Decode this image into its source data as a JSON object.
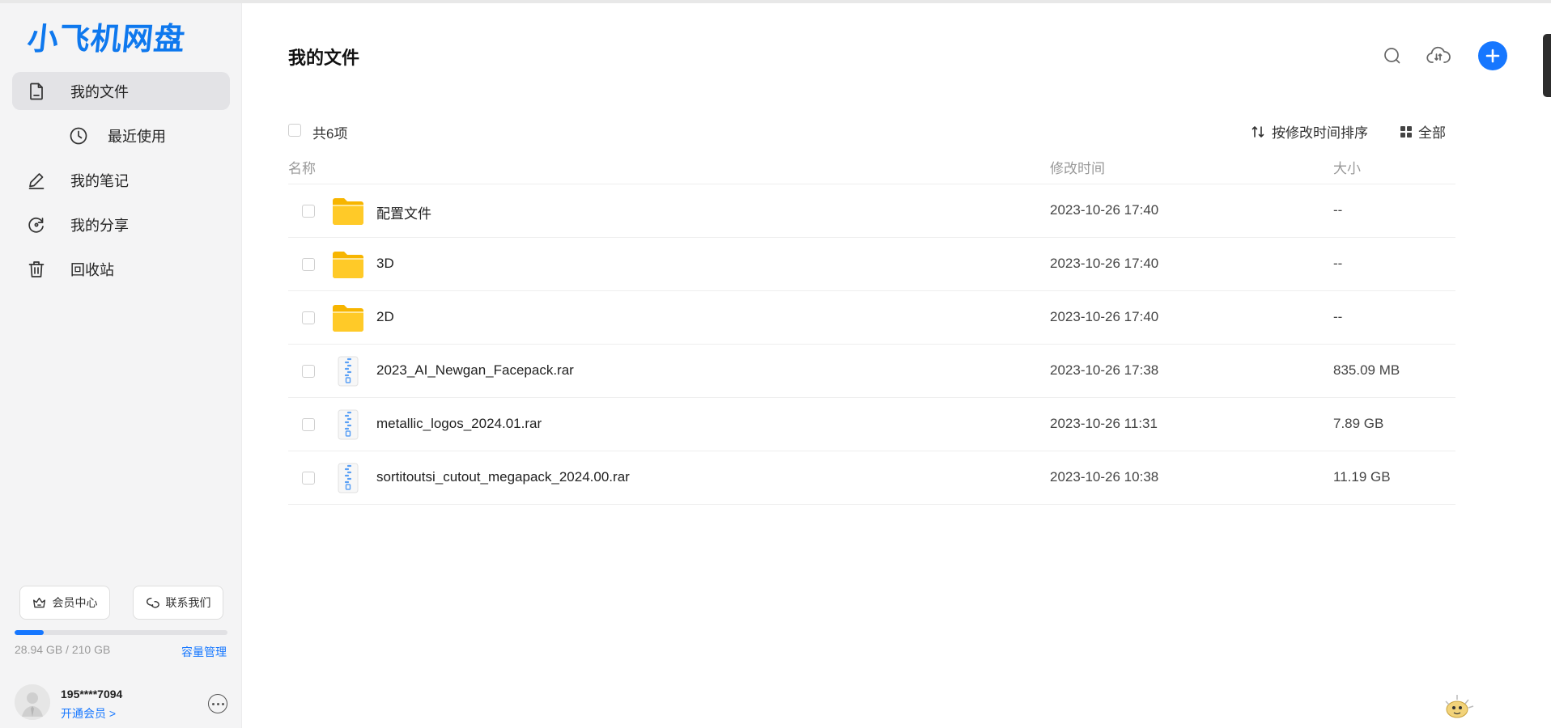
{
  "app": {
    "logo_text": "小飞机网盘",
    "brand_color": "#1677ff"
  },
  "sidebar": {
    "items": [
      {
        "label": "我的文件",
        "icon": "file-icon",
        "active": true
      },
      {
        "label": "最近使用",
        "icon": "clock-icon",
        "active": false
      },
      {
        "label": "我的笔记",
        "icon": "pen-icon",
        "active": false
      },
      {
        "label": "我的分享",
        "icon": "share-icon",
        "active": false
      },
      {
        "label": "回收站",
        "icon": "trash-icon",
        "active": false
      }
    ],
    "member_center_label": "会员中心",
    "contact_label": "联系我们",
    "storage": {
      "text": "28.94 GB / 210 GB",
      "used_fraction": 0.138,
      "manage_label": "容量管理"
    },
    "user": {
      "name": "195****7094",
      "vip_link": "开通会员 >"
    }
  },
  "main": {
    "title": "我的文件",
    "toolbar": {
      "count": "共6项",
      "sort_label": "按修改时间排序",
      "view_label": "全部"
    },
    "columns": {
      "name": "名称",
      "date": "修改时间",
      "size": "大小"
    },
    "files": [
      {
        "name": "配置文件",
        "type": "folder",
        "date": "2023-10-26 17:40",
        "size": "--"
      },
      {
        "name": "3D",
        "type": "folder",
        "date": "2023-10-26 17:40",
        "size": "--"
      },
      {
        "name": "2D",
        "type": "folder",
        "date": "2023-10-26 17:40",
        "size": "--"
      },
      {
        "name": "2023_AI_Newgan_Facepack.rar",
        "type": "archive",
        "date": "2023-10-26 17:38",
        "size": "835.09 MB"
      },
      {
        "name": "metallic_logos_2024.01.rar",
        "type": "archive",
        "date": "2023-10-26 11:31",
        "size": "7.89 GB"
      },
      {
        "name": "sortitoutsi_cutout_megapack_2024.00.rar",
        "type": "archive",
        "date": "2023-10-26 10:38",
        "size": "11.19 GB"
      }
    ]
  }
}
